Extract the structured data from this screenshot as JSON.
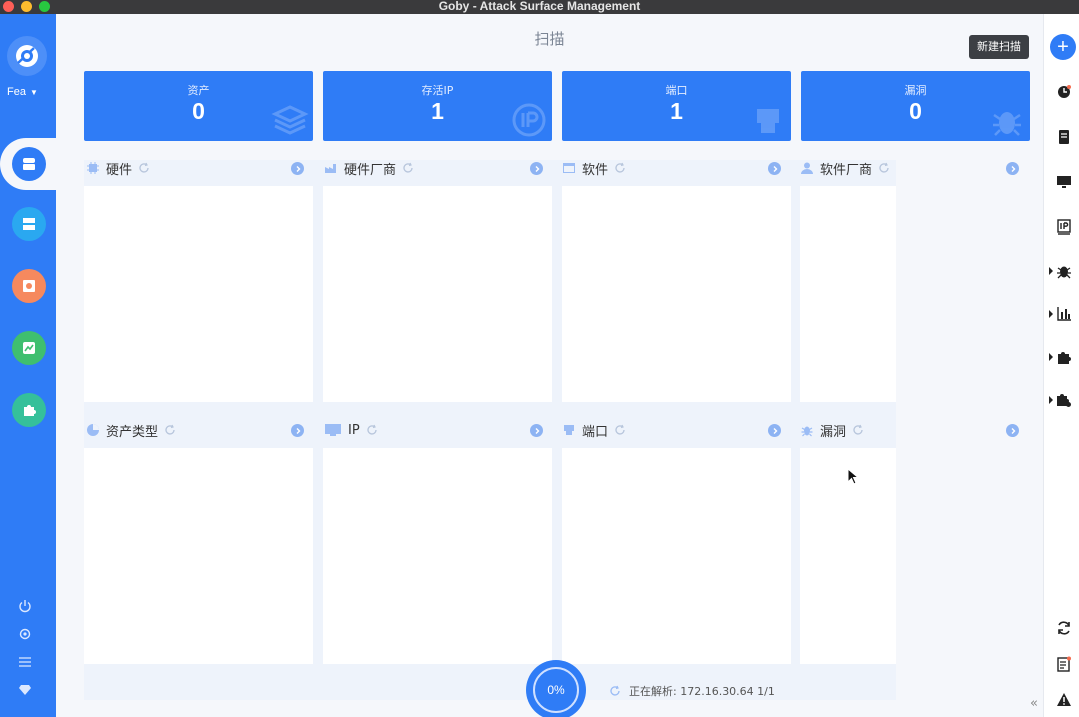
{
  "window": {
    "title": "Goby - Attack Surface Management"
  },
  "sidebar": {
    "user": "Fea"
  },
  "header": {
    "title": "扫描",
    "new_scan": "新建扫描"
  },
  "stats": [
    {
      "label": "资产",
      "value": "0"
    },
    {
      "label": "存活IP",
      "value": "1"
    },
    {
      "label": "端口",
      "value": "1"
    },
    {
      "label": "漏洞",
      "value": "0"
    }
  ],
  "panels": [
    {
      "title": "硬件"
    },
    {
      "title": "硬件厂商"
    },
    {
      "title": "软件"
    },
    {
      "title": "软件厂商"
    },
    {
      "title": "资产类型"
    },
    {
      "title": "IP"
    },
    {
      "title": "端口"
    },
    {
      "title": "漏洞"
    }
  ],
  "progress": {
    "percent_label": "0%",
    "percent": 0
  },
  "status": {
    "parsing": "正在解析: 172.16.30.64 1/1"
  },
  "colors": {
    "primary": "#2f7cf6",
    "bg": "#f5f7fb"
  }
}
